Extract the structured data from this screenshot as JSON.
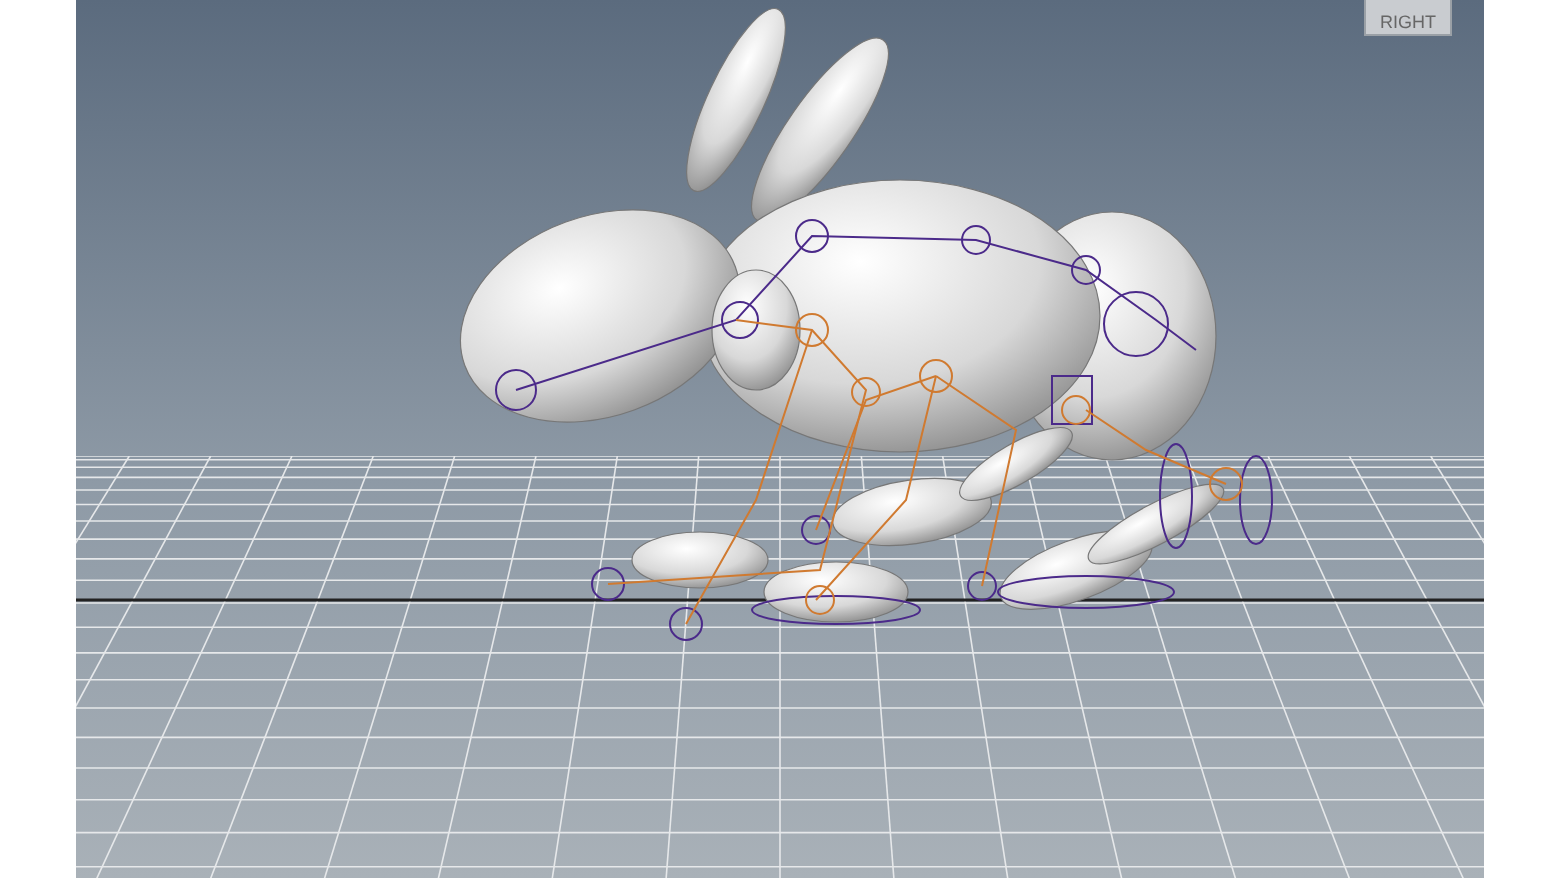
{
  "viewport": {
    "view_cube": {
      "label": "RIGHT"
    }
  }
}
